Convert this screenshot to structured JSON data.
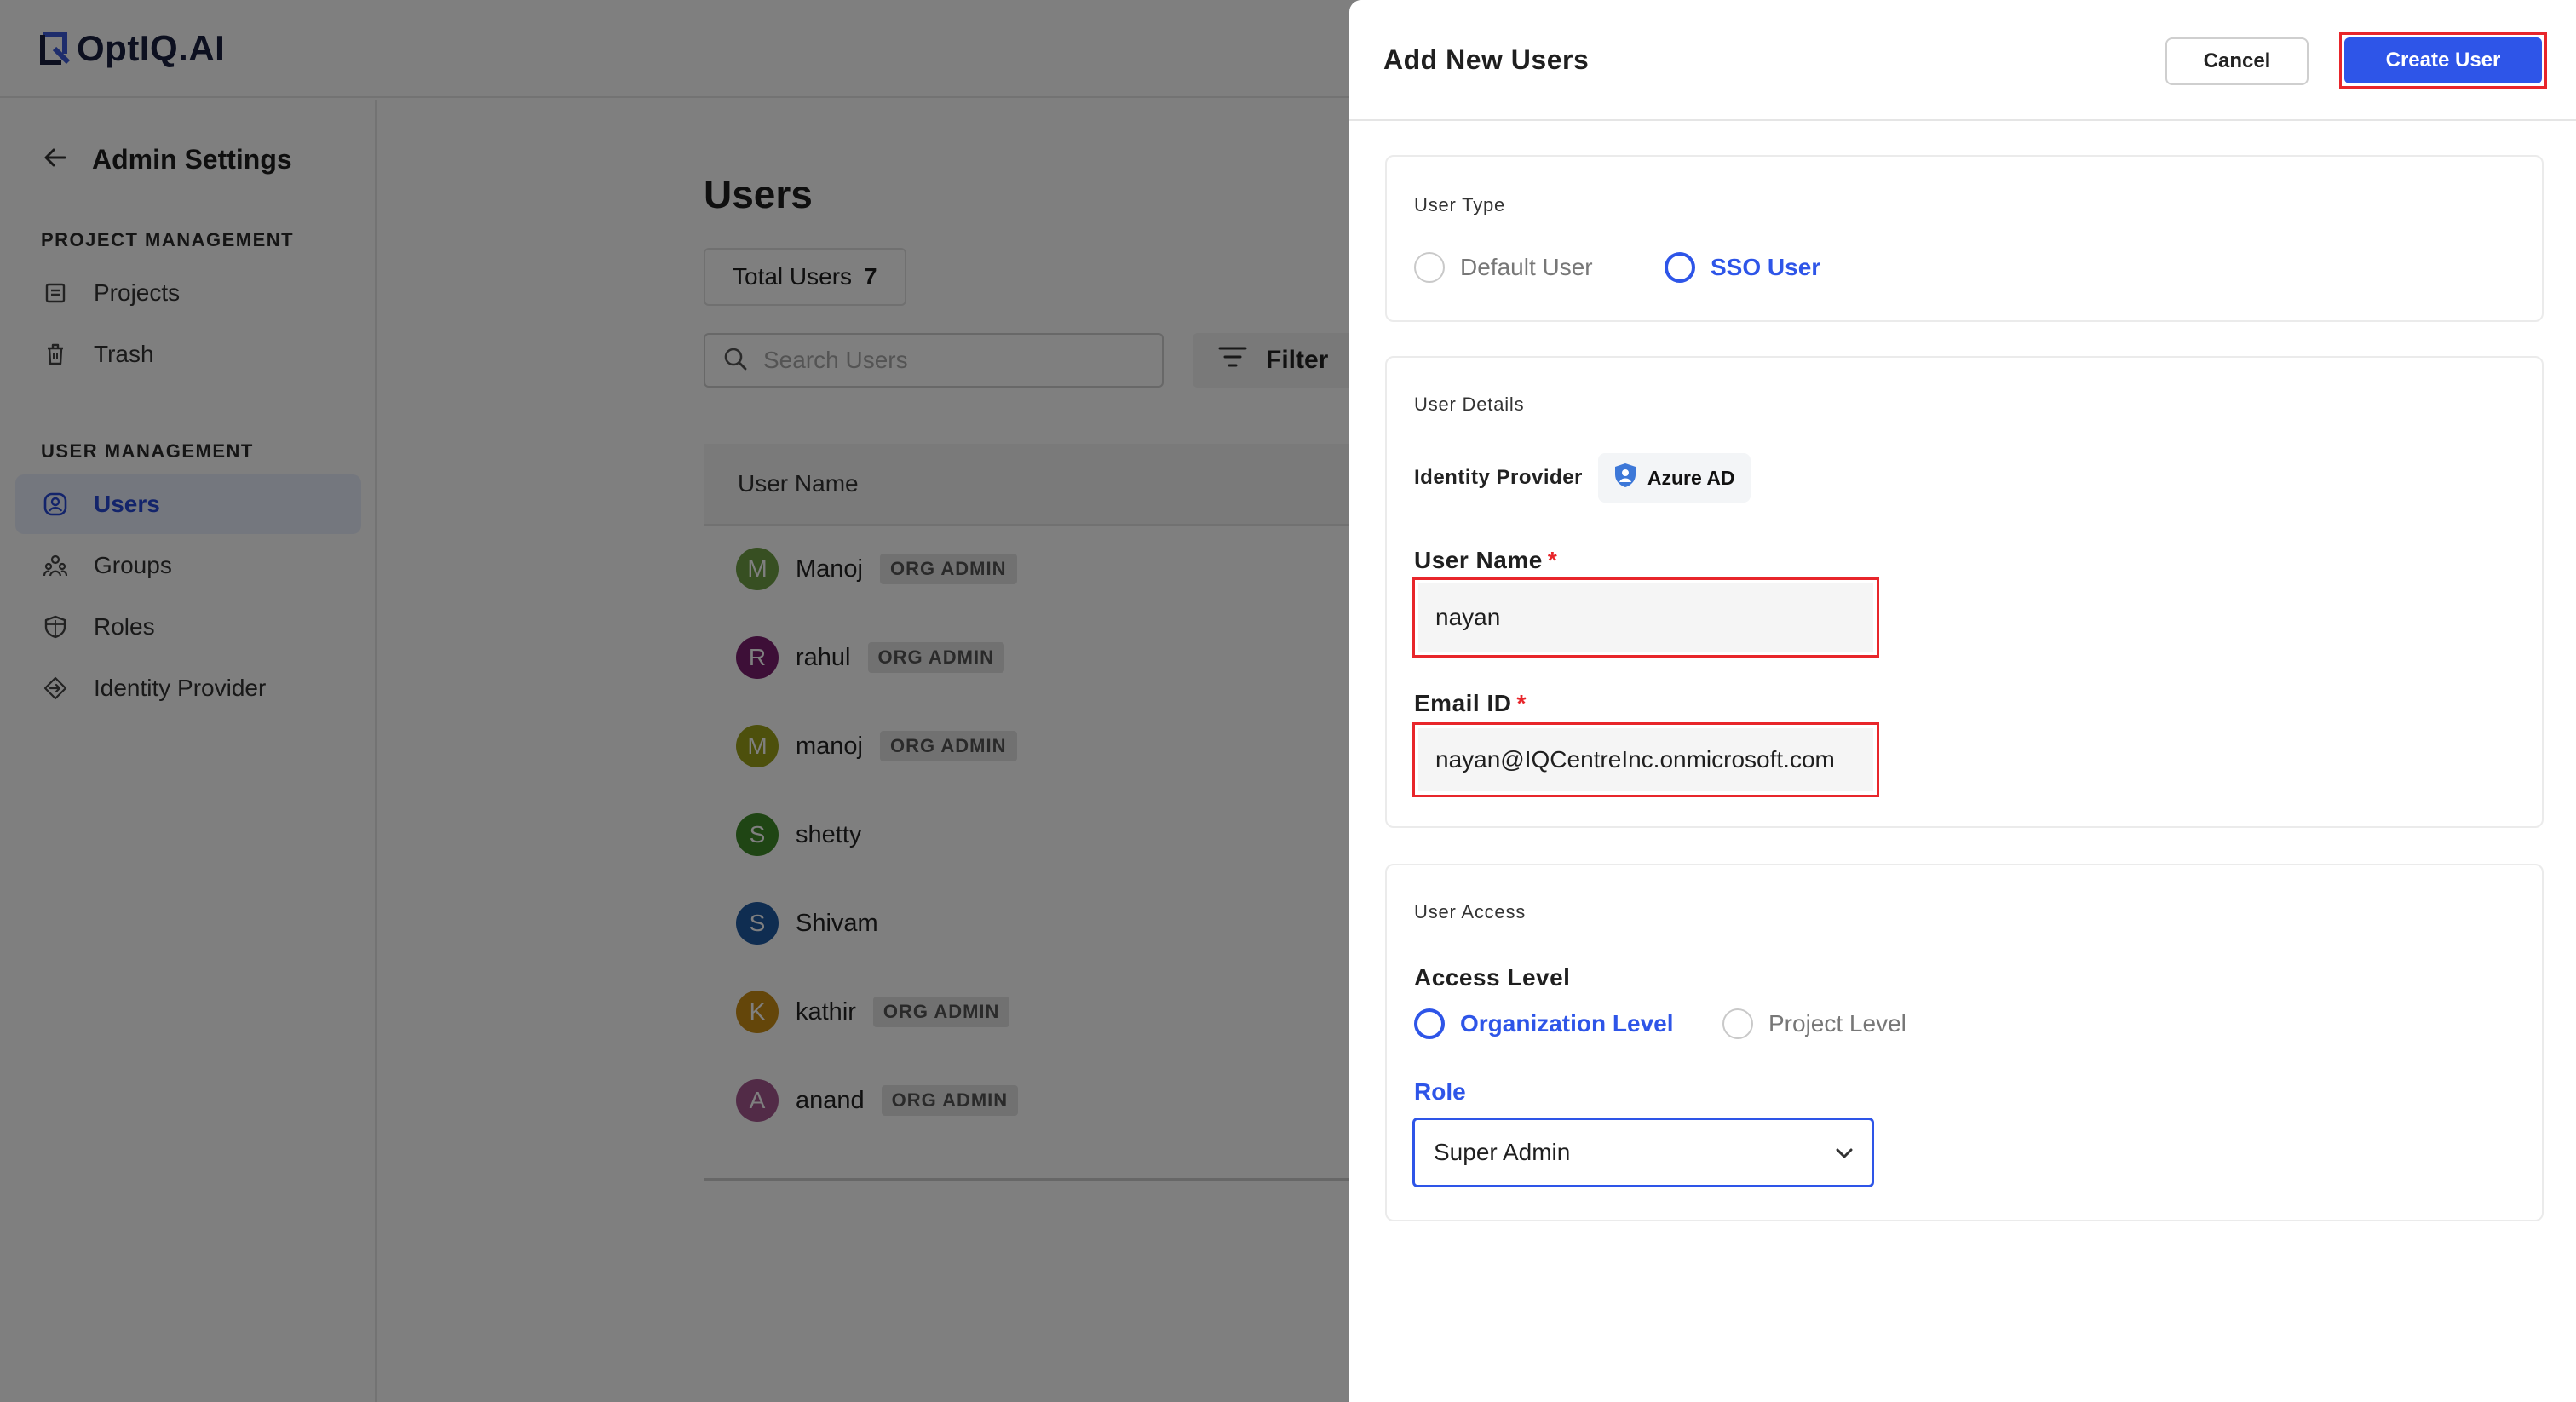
{
  "app": {
    "logo_text": "OptIQ.AI"
  },
  "sidebar": {
    "back_title": "Admin Settings",
    "sections": [
      {
        "label": "PROJECT MANAGEMENT"
      },
      {
        "label": "USER MANAGEMENT"
      }
    ],
    "items": [
      {
        "label": "Projects",
        "icon": "document-icon"
      },
      {
        "label": "Trash",
        "icon": "trash-icon"
      },
      {
        "label": "Users",
        "icon": "user-circle-icon",
        "active": true
      },
      {
        "label": "Groups",
        "icon": "group-icon"
      },
      {
        "label": "Roles",
        "icon": "shield-icon"
      },
      {
        "label": "Identity Provider",
        "icon": "login-arrow-icon"
      }
    ]
  },
  "main": {
    "title": "Users",
    "total_label": "Total Users",
    "total_count": "7",
    "search_placeholder": "Search Users",
    "filter_label": "Filter",
    "column_user_name": "User Name",
    "users": [
      {
        "initial": "M",
        "name": "Manoj",
        "tag": "ORG ADMIN",
        "color": "#6f9f45"
      },
      {
        "initial": "R",
        "name": "rahul",
        "tag": "ORG ADMIN",
        "color": "#7b1f6e"
      },
      {
        "initial": "M",
        "name": "manoj",
        "tag": "ORG ADMIN",
        "color": "#9aa019"
      },
      {
        "initial": "S",
        "name": "shetty",
        "tag": "",
        "color": "#3e8a28"
      },
      {
        "initial": "S",
        "name": "Shivam",
        "tag": "",
        "color": "#1e5aa3"
      },
      {
        "initial": "K",
        "name": "kathir",
        "tag": "ORG ADMIN",
        "color": "#c98c14"
      },
      {
        "initial": "A",
        "name": "anand",
        "tag": "ORG ADMIN",
        "color": "#a4578f"
      }
    ]
  },
  "drawer": {
    "title": "Add New Users",
    "cancel_label": "Cancel",
    "create_label": "Create User",
    "user_type": {
      "label": "User Type",
      "options": [
        {
          "label": "Default User",
          "selected": false
        },
        {
          "label": "SSO User",
          "selected": true
        }
      ]
    },
    "user_details": {
      "label": "User Details",
      "identity_provider_label": "Identity Provider",
      "identity_provider_value": "Azure AD",
      "username_label": "User Name",
      "username_value": "nayan",
      "email_label": "Email ID",
      "email_value": "nayan@IQCentreInc.onmicrosoft.com",
      "required_mark": "*"
    },
    "user_access": {
      "label": "User Access",
      "access_level_label": "Access Level",
      "options": [
        {
          "label": "Organization Level",
          "selected": true
        },
        {
          "label": "Project Level",
          "selected": false
        }
      ],
      "role_label": "Role",
      "role_value": "Super Admin"
    }
  },
  "colors": {
    "accent": "#2e55e8",
    "highlight": "#e8262b",
    "overlay": "rgba(0,0,0,0.5)"
  }
}
